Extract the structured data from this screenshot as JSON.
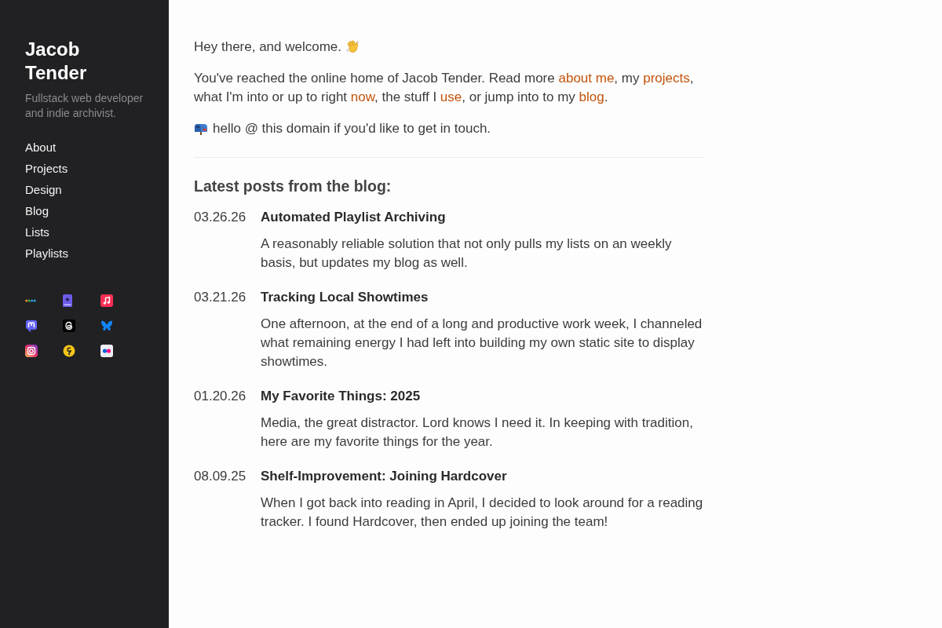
{
  "sidebar": {
    "title": "Jacob Tender",
    "tagline": "Fullstack web developer and indie archivist.",
    "nav": [
      {
        "label": "About"
      },
      {
        "label": "Projects"
      },
      {
        "label": "Design"
      },
      {
        "label": "Blog"
      },
      {
        "label": "Lists"
      },
      {
        "label": "Playlists"
      }
    ]
  },
  "main": {
    "greeting": "Hey there, and welcome.",
    "intro": [
      {
        "kind": "text",
        "text": "You've reached the online home of Jacob Tender. Read more "
      },
      {
        "kind": "link",
        "text": "about me"
      },
      {
        "kind": "text",
        "text": ", my "
      },
      {
        "kind": "link",
        "text": "projects"
      },
      {
        "kind": "text",
        "text": ", what I'm into or up to right "
      },
      {
        "kind": "link",
        "text": "now"
      },
      {
        "kind": "text",
        "text": ", the stuff I "
      },
      {
        "kind": "link",
        "text": "use"
      },
      {
        "kind": "text",
        "text": ", or jump into to my "
      },
      {
        "kind": "link",
        "text": "blog"
      },
      {
        "kind": "text",
        "text": "."
      }
    ],
    "contact": "hello @ this domain if you'd like to get in touch."
  },
  "blog": {
    "heading": "Latest posts from the blog:",
    "posts": [
      {
        "date": "03.26.26",
        "title": "Automated Playlist Archiving",
        "summary": "A reasonably reliable solution that not only pulls my lists on an weekly basis, but updates my blog as well."
      },
      {
        "date": "03.21.26",
        "title": "Tracking Local Showtimes",
        "summary": "One afternoon, at the end of a long and productive work week, I channeled what remaining energy I had left into building my own static site to display showtimes."
      },
      {
        "date": "01.20.26",
        "title": "My Favorite Things: 2025",
        "summary": "Media, the great distractor. Lord knows I need it. In keeping with tradition, here are my favorite things for the year."
      },
      {
        "date": "08.09.25",
        "title": "Shelf-Improvement: Joining Hardcover",
        "summary": "When I got back into reading in April, I decided to look around for a reading tracker. I found Hardcover, then ended up joining the team!"
      }
    ]
  }
}
